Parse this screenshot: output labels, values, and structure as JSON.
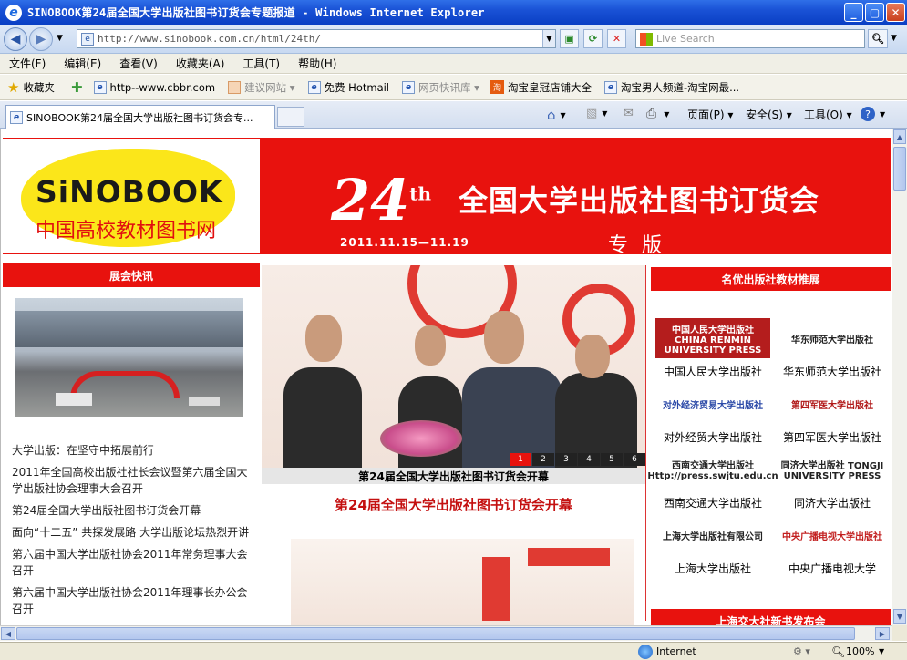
{
  "window": {
    "title": "SINOBOOK第24届全国大学出版社图书订货会专题报道 - Windows Internet Explorer"
  },
  "address": {
    "url": "http://www.sinobook.com.cn/html/24th/",
    "search_placeholder": "Live Search"
  },
  "menu": [
    "文件(F)",
    "编辑(E)",
    "查看(V)",
    "收藏夹(A)",
    "工具(T)",
    "帮助(H)"
  ],
  "favorites": {
    "label": "收藏夹",
    "items": [
      {
        "label": "http--www.cbbr.com",
        "grey": false
      },
      {
        "label": "建议网站 ▾",
        "grey": true
      },
      {
        "label": "免费 Hotmail",
        "grey": false
      },
      {
        "label": "网页快讯库 ▾",
        "grey": true
      },
      {
        "label": "淘宝皇冠店铺大全",
        "grey": false
      },
      {
        "label": "淘宝男人频道-淘宝网最...",
        "grey": false
      }
    ]
  },
  "tab": {
    "label": "SINOBOOK第24届全国大学出版社图书订货会专..."
  },
  "commands": {
    "page": "页面(P) ▾",
    "safety": "安全(S) ▾",
    "tools": "工具(O) ▾"
  },
  "banner": {
    "logo_en": "SiNOBOOK",
    "logo_zh": "中国高校教材图书网",
    "number": "24",
    "number_suffix": "th",
    "title": "全国大学出版社图书订货会",
    "dates": "2011.11.15—11.19",
    "subtitle": "专 版"
  },
  "left": {
    "heading": "展会快讯",
    "news": [
      "大学出版：在坚守中拓展前行",
      "2011年全国高校出版社社长会议暨第六届全国大学出版社协会理事大会召开",
      "第24届全国大学出版社图书订货会开幕",
      "面向“十二五” 共探发展路  大学出版论坛热烈开讲",
      "第六届中国大学出版社协会2011年常务理事大会召开",
      "第六届中国大学出版社协会2011年理事长办公会召开"
    ]
  },
  "center": {
    "slider_numbers": [
      "1",
      "2",
      "3",
      "4",
      "5",
      "6"
    ],
    "active_slide": "1",
    "caption": "第24届全国大学出版社图书订货会开幕",
    "article_title": "第24届全国大学出版社图书订货会开幕"
  },
  "right": {
    "heading": "名优出版社教材推展",
    "publishers": [
      {
        "name": "中国人民大学出版社",
        "logo_text": "中国人民大学出版社 CHINA RENMIN UNIVERSITY PRESS",
        "color": "#b41d1d"
      },
      {
        "name": "华东师范大学出版社",
        "logo_text": "华东师范大学出版社",
        "color": "#ffffff"
      },
      {
        "name": "对外经贸大学出版社",
        "logo_text": "对外经济贸易大学出版社",
        "color": "#ffffff"
      },
      {
        "name": "第四军医大学出版社",
        "logo_text": "第四军医大学出版社",
        "color": "#ffffff"
      },
      {
        "name": "西南交通大学出版社",
        "logo_text": "西南交通大学出版社 Http://press.swjtu.edu.cn",
        "color": "#ffffff"
      },
      {
        "name": "同济大学出版社",
        "logo_text": "同济大学出版社 TONGJI UNIVERSITY PRESS",
        "color": "#ffffff"
      },
      {
        "name": "上海大学出版社",
        "logo_text": "上海大学出版社有限公司",
        "color": "#ffffff"
      },
      {
        "name": "中央广播电视大学",
        "logo_text": "中央广播电视大学出版社",
        "color": "#ffffff"
      }
    ],
    "heading2": "上海交大社新书发布会"
  },
  "status": {
    "zone": "Internet",
    "zoom": "100%"
  },
  "colors": {
    "brand_red": "#e8120e",
    "logo_yellow": "#fbe61a",
    "title_blue": "#1a52d6"
  }
}
